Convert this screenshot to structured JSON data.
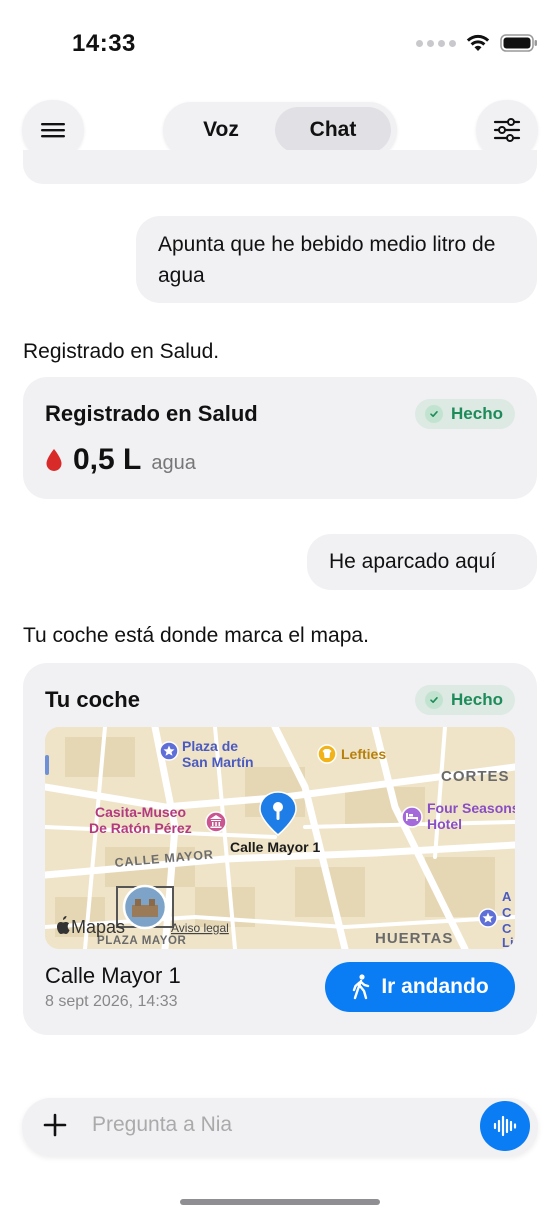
{
  "status": {
    "time": "14:33"
  },
  "nav": {
    "tab_voice": "Voz",
    "tab_chat": "Chat",
    "active_tab": "Chat"
  },
  "messages": {
    "user_1": "Apunta que he bebido medio litro de agua",
    "assistant_1": "Registrado en Salud.",
    "user_2": "He aparcado aquí",
    "assistant_2": "Tu coche está donde marca el mapa."
  },
  "health_card": {
    "title": "Registrado en Salud",
    "badge": "Hecho",
    "value": "0,5 L",
    "label": "agua",
    "icon": "water-drop-icon"
  },
  "car_card": {
    "title": "Tu coche",
    "badge": "Hecho",
    "map": {
      "labels": {
        "plaza_san_martin_1": "Plaza de",
        "plaza_san_martin_2": "San Martín",
        "lefties": "Lefties",
        "cortes": "CORTES",
        "casita_1": "Casita-Museo",
        "casita_2": "De Ratón Pérez",
        "four_seasons_1": "Four Seasons",
        "four_seasons_2": "Hotel",
        "calle_mayor_street": "CALLE MAYOR",
        "pin_label": "Calle Mayor 1",
        "plaza_mayor": "PLAZA MAYOR",
        "huertas": "HUERTAS",
        "maps_brand": "Mapas",
        "legal": "Aviso legal",
        "edge_a": "A",
        "edge_c1": "C",
        "edge_c2": "C",
        "edge_li": "Li"
      }
    },
    "location_name": "Calle Mayor 1",
    "date": "8 sept 2026, 14:33",
    "action_label": "Ir andando"
  },
  "input": {
    "placeholder": "Pregunta a Nia"
  },
  "colors": {
    "accent": "#0a7cf4",
    "done_green": "#1e8c5a",
    "drop_red": "#d92a2a",
    "card_bg": "#f1f1f4"
  }
}
